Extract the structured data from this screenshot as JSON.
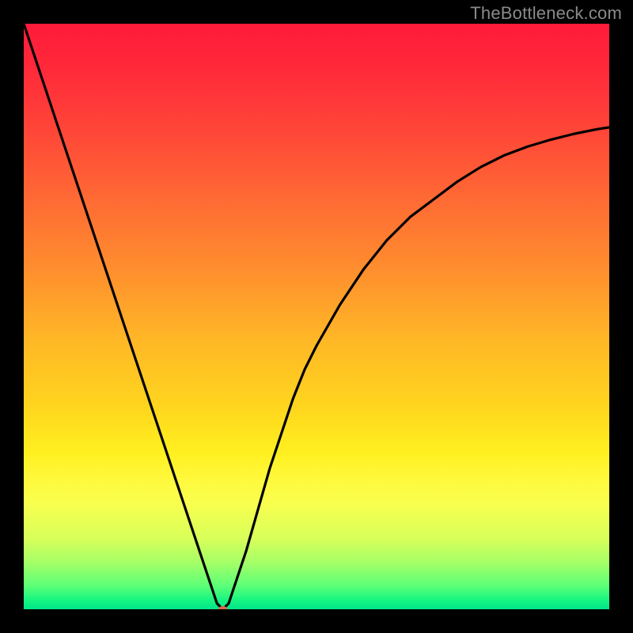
{
  "watermark": {
    "text": "TheBottleneck.com"
  },
  "chart_data": {
    "type": "line",
    "title": "",
    "xlabel": "",
    "ylabel": "",
    "xlim": [
      0,
      100
    ],
    "ylim": [
      0,
      100
    ],
    "grid": false,
    "legend": false,
    "series": [
      {
        "name": "curve",
        "color": "#000000",
        "x": [
          0,
          2,
          4,
          6,
          8,
          10,
          12,
          14,
          16,
          18,
          20,
          22,
          24,
          26,
          28,
          30,
          32,
          33,
          34,
          35,
          36,
          38,
          40,
          42,
          44,
          46,
          48,
          50,
          54,
          58,
          62,
          66,
          70,
          74,
          78,
          82,
          86,
          90,
          94,
          98,
          100
        ],
        "y": [
          100,
          94,
          88,
          82,
          76,
          70,
          64,
          58,
          52,
          46,
          40,
          34,
          28,
          22,
          16,
          10,
          4,
          1,
          0,
          1,
          4,
          10,
          17,
          24,
          30,
          36,
          41,
          45,
          52,
          58,
          63,
          67,
          70,
          73,
          75.5,
          77.5,
          79,
          80.2,
          81.2,
          82,
          82.3
        ]
      }
    ],
    "marker": {
      "name": "vertex-marker",
      "x": 34,
      "y": 0,
      "color": "#d2694e",
      "rx": 6,
      "ry": 4
    },
    "annotations": [
      {
        "text": "TheBottleneck.com",
        "position": "top-right",
        "color": "#8a8a8a"
      }
    ]
  }
}
